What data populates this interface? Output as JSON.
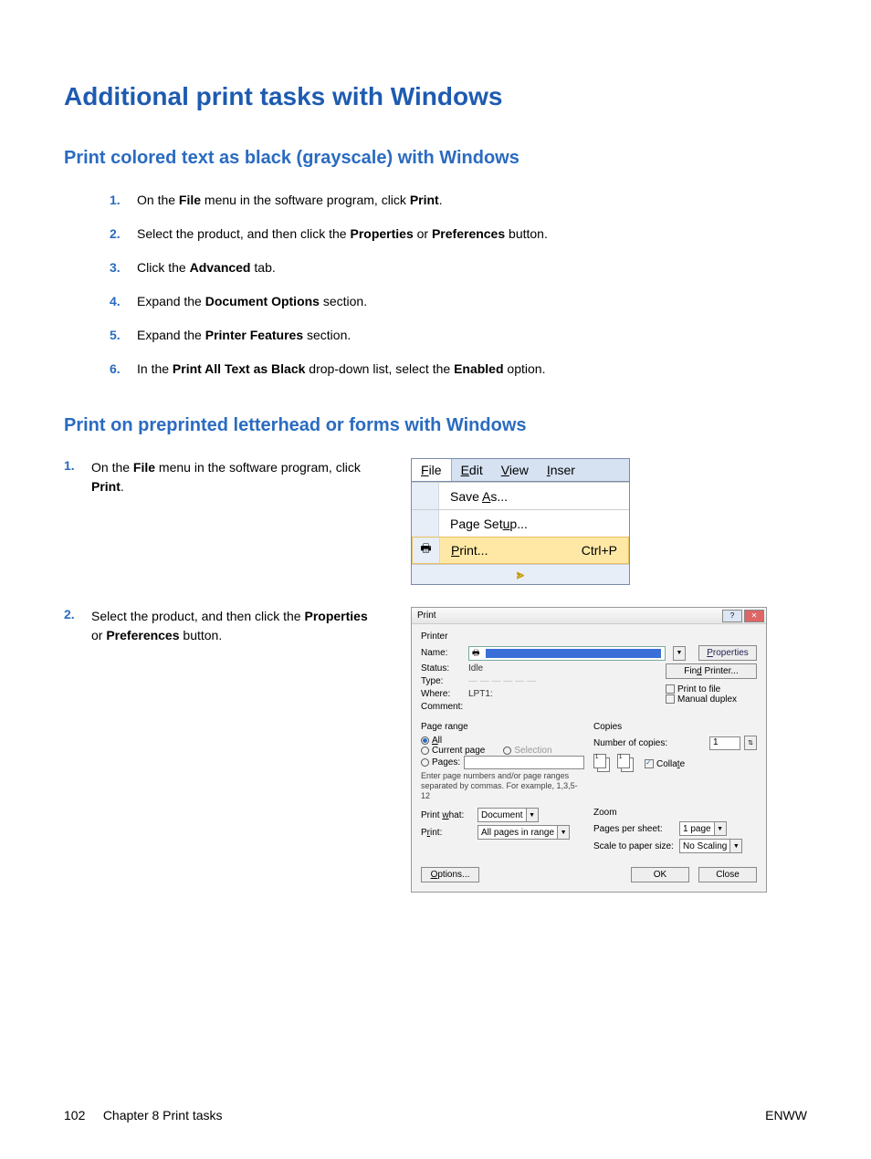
{
  "h1": "Additional print tasks with Windows",
  "h2a": "Print colored text as black (grayscale) with Windows",
  "h2b": "Print on preprinted letterhead or forms with Windows",
  "steps_a": [
    {
      "n": "1.",
      "pre": "On the ",
      "b1": "File",
      "mid1": " menu in the software program, click ",
      "b2": "Print",
      "post": "."
    },
    {
      "n": "2.",
      "pre": "Select the product, and then click the ",
      "b1": "Properties",
      "mid1": " or ",
      "b2": "Preferences",
      "post": " button."
    },
    {
      "n": "3.",
      "pre": "Click the ",
      "b1": "Advanced",
      "mid1": "",
      "b2": "",
      "post": " tab."
    },
    {
      "n": "4.",
      "pre": "Expand the ",
      "b1": "Document Options",
      "mid1": "",
      "b2": "",
      "post": " section."
    },
    {
      "n": "5.",
      "pre": "Expand the ",
      "b1": "Printer Features",
      "mid1": "",
      "b2": "",
      "post": " section."
    },
    {
      "n": "6.",
      "pre": "In the ",
      "b1": "Print All Text as Black",
      "mid1": " drop-down list, select the ",
      "b2": "Enabled",
      "post": " option."
    }
  ],
  "steps_b": [
    {
      "n": "1.",
      "pre": "On the ",
      "b1": "File",
      "mid1": " menu in the software program, click ",
      "b2": "Print",
      "post": "."
    },
    {
      "n": "2.",
      "pre": "Select the product, and then click the ",
      "b1": "Properties",
      "mid1": " or ",
      "b2": "Preferences",
      "post": " button."
    }
  ],
  "menu": {
    "menubar": [
      "File",
      "Edit",
      "View",
      "Inser"
    ],
    "items": [
      {
        "label": "Save As...",
        "shortcut": "",
        "icon": ""
      },
      {
        "label": "Page Setup...",
        "shortcut": "",
        "icon": ""
      },
      {
        "label": "Print...",
        "shortcut": "Ctrl+P",
        "icon": "🖶"
      }
    ]
  },
  "pdlg": {
    "title": "Print",
    "printer_label": "Printer",
    "name_label": "Name:",
    "properties_btn": "Properties",
    "find_printer_btn": "Find Printer...",
    "status_label": "Status:",
    "status_val": "Idle",
    "type_label": "Type:",
    "type_val": "",
    "where_label": "Where:",
    "where_val": "LPT1:",
    "comment_label": "Comment:",
    "print_to_file": "Print to file",
    "manual_duplex": "Manual duplex",
    "page_range_label": "Page range",
    "all": "All",
    "current": "Current page",
    "selection": "Selection",
    "pages": "Pages:",
    "pages_hint": "Enter page numbers and/or page ranges separated by commas. For example, 1,3,5-12",
    "copies_label": "Copies",
    "num_copies_label": "Number of copies:",
    "num_copies_val": "1",
    "collate": "Collate",
    "print_what_label": "Print what:",
    "print_what_val": "Document",
    "print_label": "Print:",
    "print_val": "All pages in range",
    "zoom_label": "Zoom",
    "pps_label": "Pages per sheet:",
    "pps_val": "1 page",
    "scale_label": "Scale to paper size:",
    "scale_val": "No Scaling",
    "options_btn": "Options...",
    "ok_btn": "OK",
    "close_btn": "Close"
  },
  "footer": {
    "page": "102",
    "chapter": "Chapter 8   Print tasks",
    "right": "ENWW"
  }
}
